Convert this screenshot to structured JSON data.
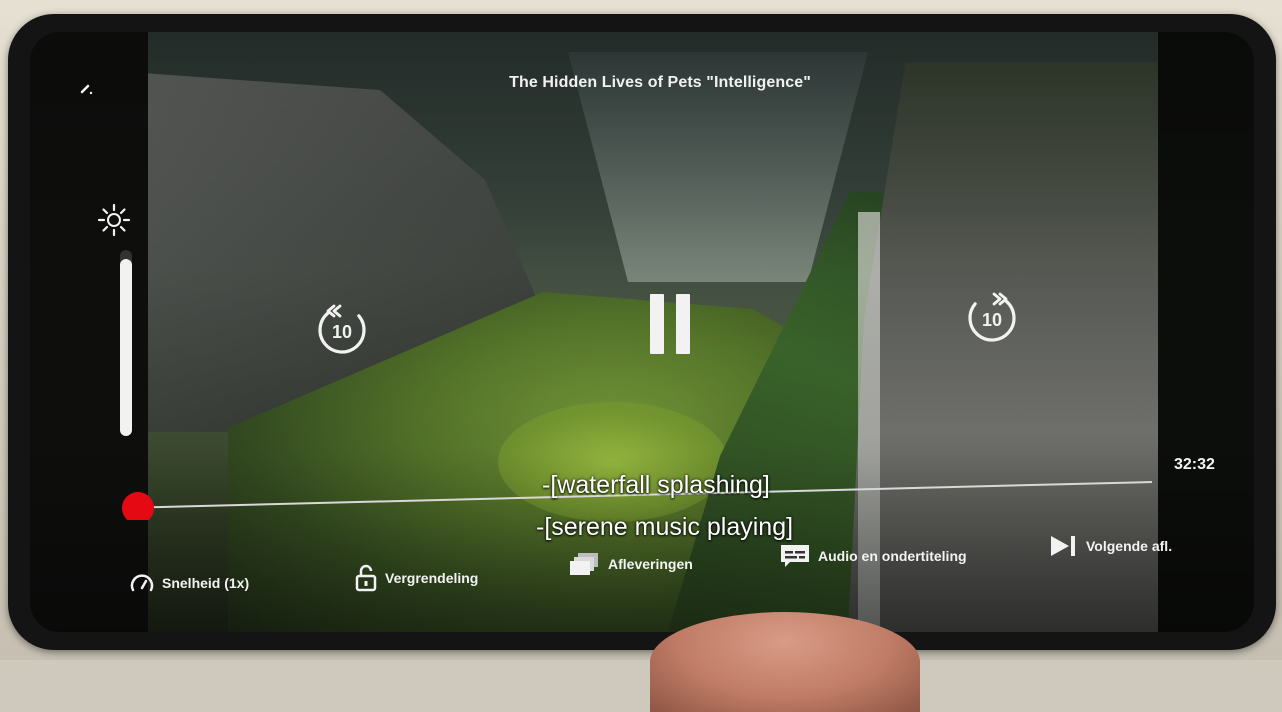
{
  "player": {
    "title": "The Hidden Lives of Pets  \"Intelligence\"",
    "time_remaining": "32:32",
    "progress_fraction": 0.0,
    "brightness_fraction": 0.95,
    "skip_back_seconds": "10",
    "skip_forward_seconds": "10",
    "subtitles": [
      "-[waterfall splashing]",
      "-[serene music playing]"
    ],
    "colors": {
      "progress_thumb": "#e50914",
      "progress_track": "#d8d8d8",
      "icon": "#f2f2f2"
    }
  },
  "controls": {
    "speed_label": "Snelheid (1x)",
    "lock_label": "Vergrendeling",
    "episodes_label": "Afleveringen",
    "audio_subs_label": "Audio en ondertiteling",
    "next_episode_label": "Volgende afl."
  },
  "icons": {
    "back": "back-arrow-icon",
    "brightness": "sun-icon",
    "skip_back": "replay-10-icon",
    "skip_forward": "forward-10-icon",
    "pause": "pause-icon",
    "speed": "speedometer-icon",
    "lock": "unlock-icon",
    "episodes": "episodes-stack-icon",
    "audio": "subtitles-icon",
    "next": "next-episode-icon"
  }
}
